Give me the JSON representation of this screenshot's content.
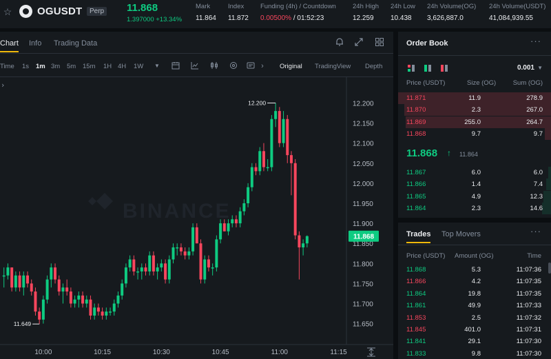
{
  "header": {
    "symbol": "OGUSDT",
    "contract_type": "Perp",
    "last_price": "11.868",
    "change": "1.397000 +13.34%",
    "stats": [
      {
        "label": "Mark",
        "value": "11.864"
      },
      {
        "label": "Index",
        "value": "11.872"
      },
      {
        "label": "Funding (4h) / Countdown",
        "value_red": "0.00500%",
        "value": " / 01:52:23"
      },
      {
        "label": "24h High",
        "value": "12.259"
      },
      {
        "label": "24h Low",
        "value": "10.438"
      },
      {
        "label": "24h Volume(OG)",
        "value": "3,626,887.0"
      },
      {
        "label": "24h Volume(USDT)",
        "value": "41,084,939.55"
      }
    ]
  },
  "chart_tabs": [
    "Chart",
    "Info",
    "Trading Data"
  ],
  "toolbar": {
    "timeframes": [
      "Time",
      "1s",
      "1m",
      "3m",
      "5m",
      "15m",
      "1H",
      "4H",
      "1W"
    ],
    "active_timeframe": "1m",
    "views": [
      "Original",
      "TradingView",
      "Depth"
    ],
    "active_view": "Original"
  },
  "icons": {
    "favorite": "star-icon",
    "alert": "bell-icon",
    "fullscreen": "expand-icon",
    "layout": "grid-icon",
    "more": "more-icon"
  },
  "colors": {
    "up": "#0ecb81",
    "down": "#f6465d",
    "accent": "#f0b90b",
    "background": "#161a1e"
  },
  "chart_data": {
    "type": "candlestick",
    "watermark": "BINANCE",
    "y_ticks": [
      "12.200",
      "12.150",
      "12.100",
      "12.050",
      "12.000",
      "11.950",
      "11.900",
      "11.850",
      "11.800",
      "11.750",
      "11.700",
      "11.650"
    ],
    "ylim": [
      11.615,
      12.23
    ],
    "x_ticks": [
      "10:00",
      "10:15",
      "10:30",
      "10:45",
      "11:00",
      "11:15"
    ],
    "x_tick_minutes": [
      600,
      615,
      630,
      645,
      660,
      675
    ],
    "x_range_minutes": [
      589,
      677
    ],
    "current_price": "11.868",
    "max_label": "12.200",
    "min_label": "11.649",
    "candles": [
      [
        590,
        11.77,
        11.79,
        11.74,
        11.77
      ],
      [
        591,
        11.77,
        11.8,
        11.76,
        11.79
      ],
      [
        592,
        11.79,
        11.79,
        11.73,
        11.74
      ],
      [
        593,
        11.74,
        11.78,
        11.73,
        11.77
      ],
      [
        594,
        11.77,
        11.78,
        11.73,
        11.74
      ],
      [
        595,
        11.74,
        11.78,
        11.72,
        11.77
      ],
      [
        596,
        11.77,
        11.78,
        11.74,
        11.75
      ],
      [
        597,
        11.75,
        11.76,
        11.72,
        11.73
      ],
      [
        598,
        11.73,
        11.74,
        11.67,
        11.68
      ],
      [
        599,
        11.68,
        11.69,
        11.649,
        11.66
      ],
      [
        600,
        11.66,
        11.72,
        11.65,
        11.71
      ],
      [
        601,
        11.71,
        11.77,
        11.7,
        11.76
      ],
      [
        602,
        11.76,
        11.8,
        11.74,
        11.79
      ],
      [
        603,
        11.79,
        11.8,
        11.75,
        11.76
      ],
      [
        604,
        11.76,
        11.77,
        11.72,
        11.73
      ],
      [
        605,
        11.73,
        11.75,
        11.7,
        11.74
      ],
      [
        606,
        11.74,
        11.76,
        11.72,
        11.73
      ],
      [
        607,
        11.73,
        11.74,
        11.69,
        11.7
      ],
      [
        608,
        11.7,
        11.72,
        11.69,
        11.71
      ],
      [
        609,
        11.71,
        11.73,
        11.69,
        11.72
      ],
      [
        610,
        11.72,
        11.73,
        11.69,
        11.7
      ],
      [
        611,
        11.7,
        11.72,
        11.69,
        11.71
      ],
      [
        612,
        11.71,
        11.72,
        11.66,
        11.67
      ],
      [
        613,
        11.67,
        11.7,
        11.66,
        11.69
      ],
      [
        614,
        11.69,
        11.7,
        11.67,
        11.68
      ],
      [
        615,
        11.68,
        11.69,
        11.66,
        11.67
      ],
      [
        616,
        11.67,
        11.69,
        11.66,
        11.68
      ],
      [
        617,
        11.68,
        11.69,
        11.67,
        11.68
      ],
      [
        618,
        11.68,
        11.71,
        11.67,
        11.7
      ],
      [
        619,
        11.7,
        11.73,
        11.69,
        11.72
      ],
      [
        620,
        11.72,
        11.76,
        11.71,
        11.75
      ],
      [
        621,
        11.75,
        11.8,
        11.74,
        11.79
      ],
      [
        622,
        11.79,
        11.82,
        11.78,
        11.81
      ],
      [
        623,
        11.81,
        11.82,
        11.77,
        11.78
      ],
      [
        624,
        11.78,
        11.79,
        11.76,
        11.78
      ],
      [
        625,
        11.78,
        11.8,
        11.76,
        11.79
      ],
      [
        626,
        11.79,
        11.8,
        11.77,
        11.78
      ],
      [
        627,
        11.78,
        11.83,
        11.77,
        11.82
      ],
      [
        628,
        11.82,
        11.83,
        11.77,
        11.78
      ],
      [
        629,
        11.78,
        11.8,
        11.76,
        11.79
      ],
      [
        630,
        11.79,
        11.81,
        11.78,
        11.8
      ],
      [
        631,
        11.8,
        11.81,
        11.75,
        11.76
      ],
      [
        632,
        11.76,
        11.82,
        11.75,
        11.81
      ],
      [
        633,
        11.81,
        11.85,
        11.8,
        11.84
      ],
      [
        634,
        11.84,
        11.85,
        11.82,
        11.84
      ],
      [
        635,
        11.84,
        11.85,
        11.82,
        11.83
      ],
      [
        636,
        11.83,
        11.84,
        11.81,
        11.82
      ],
      [
        637,
        11.82,
        11.84,
        11.81,
        11.83
      ],
      [
        638,
        11.83,
        11.9,
        11.82,
        11.89
      ],
      [
        639,
        11.89,
        11.9,
        11.85,
        11.85
      ],
      [
        640,
        11.85,
        11.86,
        11.75,
        11.76
      ],
      [
        641,
        11.76,
        11.82,
        11.75,
        11.81
      ],
      [
        642,
        11.81,
        11.82,
        11.78,
        11.79
      ],
      [
        643,
        11.79,
        11.8,
        11.77,
        11.79
      ],
      [
        644,
        11.79,
        11.87,
        11.78,
        11.86
      ],
      [
        645,
        11.86,
        11.91,
        11.85,
        11.9
      ],
      [
        646,
        11.9,
        11.91,
        11.88,
        11.88
      ],
      [
        647,
        11.88,
        11.91,
        11.87,
        11.9
      ],
      [
        648,
        11.9,
        11.92,
        11.89,
        11.91
      ],
      [
        649,
        11.91,
        11.92,
        11.89,
        11.9
      ],
      [
        650,
        11.9,
        11.94,
        11.89,
        11.93
      ],
      [
        651,
        11.93,
        11.96,
        11.92,
        11.95
      ],
      [
        652,
        11.95,
        12.0,
        11.94,
        11.99
      ],
      [
        653,
        11.99,
        12.05,
        11.98,
        12.04
      ],
      [
        654,
        12.04,
        12.05,
        12.02,
        12.03
      ],
      [
        655,
        12.03,
        12.09,
        12.02,
        12.08
      ],
      [
        656,
        12.08,
        12.1,
        12.03,
        12.04
      ],
      [
        657,
        12.04,
        12.06,
        12.03,
        12.04
      ],
      [
        658,
        12.04,
        12.17,
        12.03,
        12.16
      ],
      [
        659,
        12.16,
        12.2,
        12.14,
        12.18
      ],
      [
        660,
        12.18,
        12.19,
        12.09,
        12.1
      ],
      [
        661,
        12.1,
        12.18,
        12.09,
        12.16
      ],
      [
        662,
        12.16,
        12.17,
        12.05,
        12.07
      ],
      [
        663,
        12.07,
        12.08,
        11.97,
        12.05
      ],
      [
        664,
        12.05,
        12.06,
        11.86,
        11.87
      ],
      [
        665,
        11.87,
        11.88,
        11.76,
        11.84
      ],
      [
        666,
        11.84,
        11.86,
        11.82,
        11.85
      ],
      [
        667,
        11.85,
        11.87,
        11.84,
        11.868
      ]
    ]
  },
  "order_book": {
    "title": "Order Book",
    "step": "0.001",
    "columns": [
      "Price (USDT)",
      "Size (OG)",
      "Sum (OG)"
    ],
    "asks": [
      [
        "11.871",
        "11.9",
        "278.9",
        1.0
      ],
      [
        "11.870",
        "2.3",
        "267.0",
        0.96
      ],
      [
        "11.869",
        "255.0",
        "264.7",
        0.95
      ],
      [
        "11.868",
        "9.7",
        "9.7",
        0.04
      ]
    ],
    "mid_price": "11.868",
    "mid_arrow": "↑",
    "mid_mark": "11.864",
    "bids": [
      [
        "11.867",
        "6.0",
        "6.0",
        0.02
      ],
      [
        "11.866",
        "1.4",
        "7.4",
        0.03
      ],
      [
        "11.865",
        "4.9",
        "12.3",
        0.05
      ],
      [
        "11.864",
        "2.3",
        "14.6",
        0.06
      ]
    ]
  },
  "trades": {
    "tabs": [
      "Trades",
      "Top Movers"
    ],
    "columns": [
      "Price (USDT)",
      "Amount (OG)",
      "Time"
    ],
    "rows": [
      [
        "11.868",
        "5.3",
        "11:07:36",
        "up"
      ],
      [
        "11.866",
        "4.2",
        "11:07:35",
        "down"
      ],
      [
        "11.864",
        "19.8",
        "11:07:35",
        "up"
      ],
      [
        "11.861",
        "49.9",
        "11:07:33",
        "up"
      ],
      [
        "11.853",
        "2.5",
        "11:07:32",
        "down"
      ],
      [
        "11.845",
        "401.0",
        "11:07:31",
        "down"
      ],
      [
        "11.841",
        "29.1",
        "11:07:30",
        "up"
      ],
      [
        "11.833",
        "9.8",
        "11:07:30",
        "up"
      ]
    ]
  }
}
